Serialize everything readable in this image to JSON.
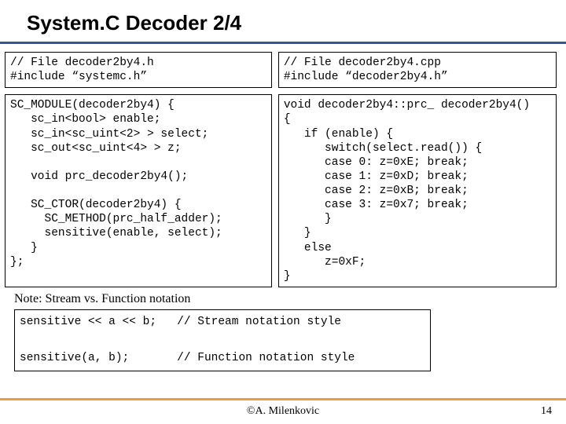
{
  "title": "System.C Decoder 2/4",
  "code_left_top": "// File decoder2by4.h\n#include “systemc.h”",
  "code_left_bottom": "SC_MODULE(decoder2by4) {\n   sc_in<bool> enable;\n   sc_in<sc_uint<2> > select;\n   sc_out<sc_uint<4> > z;\n\n   void prc_decoder2by4();\n\n   SC_CTOR(decoder2by4) {\n     SC_METHOD(prc_half_adder);\n     sensitive(enable, select);\n   }\n};",
  "code_right_top": "// File decoder2by4.cpp\n#include “decoder2by4.h”",
  "code_right_bottom": "void decoder2by4::prc_ decoder2by4()\n{\n   if (enable) {\n      switch(select.read()) {\n      case 0: z=0xE; break;\n      case 1: z=0xD; break;\n      case 2: z=0xB; break;\n      case 3: z=0x7; break;\n      }\n   }\n   else\n      z=0xF;\n}",
  "note": "Note: Stream vs. Function notation",
  "code_bottom": "sensitive << a << b;   // Stream notation style\n\nsensitive(a, b);       // Function notation style",
  "author": "©A. Milenkovic",
  "page": "14"
}
